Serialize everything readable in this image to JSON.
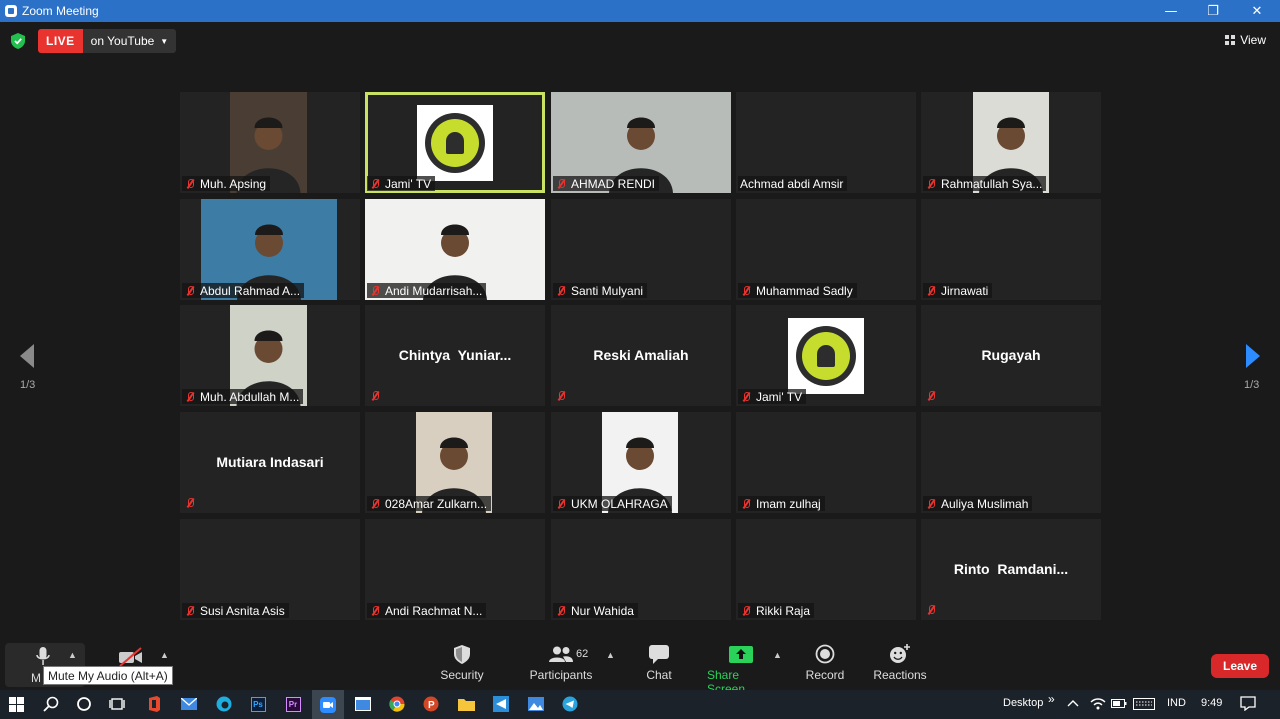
{
  "window": {
    "title": "Zoom Meeting",
    "minimize": "—",
    "restore": "❐",
    "close": "✕"
  },
  "header": {
    "live_badge": "LIVE",
    "live_destination": "on YouTube",
    "view_label": "View"
  },
  "gallery": {
    "page_indicator_left": "1/3",
    "page_indicator_right": "1/3",
    "tiles": [
      {
        "name": "Muh. Apsing",
        "type": "video"
      },
      {
        "name": "Jami' TV",
        "type": "logo",
        "active": true
      },
      {
        "name": "AHMAD RENDI",
        "type": "video"
      },
      {
        "name": "Achmad abdi Amsir",
        "type": "blank",
        "muted": false
      },
      {
        "name": "Rahmatullah Sya...",
        "type": "video"
      },
      {
        "name": "Abdul Rahmad A...",
        "type": "video"
      },
      {
        "name": "Andi Mudarrisah...",
        "type": "video"
      },
      {
        "name": "Santi Mulyani",
        "type": "blank"
      },
      {
        "name": "Muhammad Sadly",
        "type": "blank"
      },
      {
        "name": "Jirnawati",
        "type": "blank"
      },
      {
        "name": "Muh. Abdullah M...",
        "type": "video"
      },
      {
        "big_name": "Chintya  Yuniar...",
        "type": "namecard"
      },
      {
        "big_name": "Reski Amaliah",
        "type": "namecard"
      },
      {
        "name": "Jami' TV",
        "type": "logo"
      },
      {
        "big_name": "Rugayah",
        "type": "namecard"
      },
      {
        "big_name": "Mutiara Indasari",
        "type": "namecard"
      },
      {
        "name": "028Amar Zulkarn...",
        "type": "video"
      },
      {
        "name": "UKM OLAHRAGA",
        "type": "video"
      },
      {
        "name": "Imam zulhaj",
        "type": "blank"
      },
      {
        "name": "Auliya Muslimah",
        "type": "blank"
      },
      {
        "name": "Susi Asnita Asis",
        "type": "blank"
      },
      {
        "name": "Andi Rachmat N...",
        "type": "blank"
      },
      {
        "name": "Nur Wahida",
        "type": "blank"
      },
      {
        "name": "Rikki Raja",
        "type": "blank"
      },
      {
        "big_name": "Rinto  Ramdani...",
        "type": "namecard"
      }
    ]
  },
  "toolbar": {
    "mute_label": "M",
    "mute_tooltip": "Mute My Audio (Alt+A)",
    "security_label": "Security",
    "participants_label": "Participants",
    "participants_count": "62",
    "chat_label": "Chat",
    "share_label": "Share Screen",
    "record_label": "Record",
    "reactions_label": "Reactions",
    "leave_label": "Leave"
  },
  "taskbar": {
    "desktop_label": "Desktop",
    "lang": "IND",
    "time": "9:49",
    "ps_label": "Ps",
    "pr_label": "Pr",
    "ppt_label": "P"
  },
  "colors": {
    "active_speaker": "#c9e264",
    "live_red": "#e8332f",
    "share_green": "#2bd25a",
    "leave_red": "#d8282a",
    "titlebar_blue": "#2b71c7"
  }
}
